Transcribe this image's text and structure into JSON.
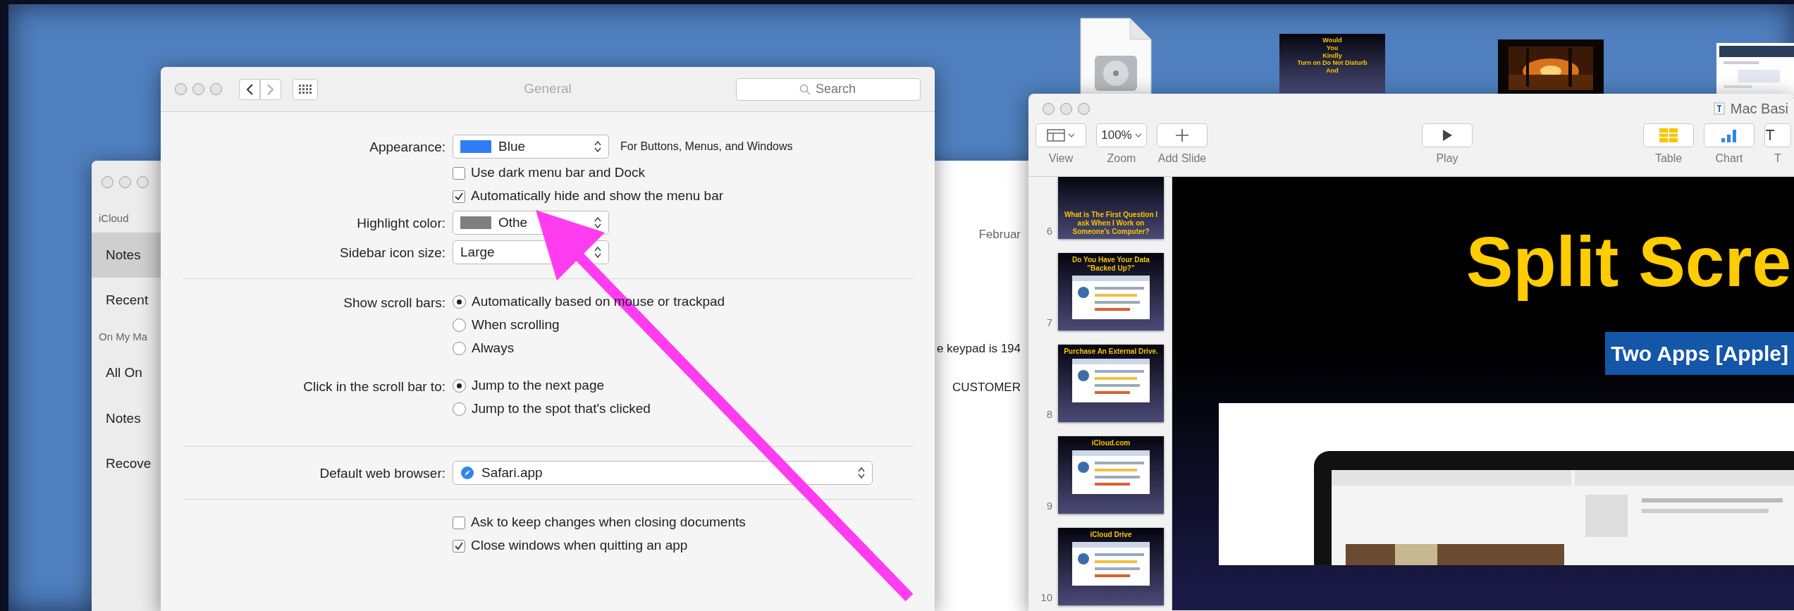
{
  "desktop_icons": [
    {
      "kind": "file"
    },
    {
      "kind": "slide",
      "text": "Would\nYou\nKindly\nTurn on Do Not Disturb\nAnd"
    },
    {
      "kind": "picture"
    },
    {
      "kind": "picture"
    }
  ],
  "notes_window": {
    "sidebar": [
      {
        "kind": "header",
        "label": "iCloud"
      },
      {
        "kind": "item",
        "label": "Notes",
        "selected": true
      },
      {
        "kind": "item",
        "label": "Recent",
        "selected": false
      },
      {
        "kind": "header",
        "label": "On My Ma"
      },
      {
        "kind": "item",
        "label": "All On",
        "selected": false
      },
      {
        "kind": "item",
        "label": "Notes",
        "selected": false
      },
      {
        "kind": "item",
        "label": "Recove",
        "selected": false
      }
    ],
    "date": "Februar",
    "note_lines": [
      "e keypad is 194",
      "CUSTOMER"
    ]
  },
  "preferences": {
    "title": "General",
    "search": {
      "placeholder": "Search"
    },
    "rows": [
      {
        "kind": "popup",
        "label": "Appearance:",
        "value": "Blue",
        "color": "#2f7cf6",
        "note": "For Buttons, Menus, and Windows"
      },
      {
        "kind": "checks",
        "options": [
          {
            "label": "Use dark menu bar and Dock",
            "checked": false
          },
          {
            "label": "Automatically hide and show the menu bar",
            "checked": true
          }
        ]
      },
      {
        "kind": "popup",
        "label": "Highlight color:",
        "value": "Othe",
        "color": "#7f7f7f"
      },
      {
        "kind": "popup",
        "label": "Sidebar icon size:",
        "value": "Large"
      },
      {
        "kind": "divider"
      },
      {
        "kind": "radios",
        "label": "Show scroll bars:",
        "options": [
          {
            "label": "Automatically based on mouse or trackpad",
            "selected": true
          },
          {
            "label": "When scrolling",
            "selected": false
          },
          {
            "label": "Always",
            "selected": false
          }
        ]
      },
      {
        "kind": "radios",
        "label": "Click in the scroll bar to:",
        "options": [
          {
            "label": "Jump to the next page",
            "selected": true
          },
          {
            "label": "Jump to the spot that's clicked",
            "selected": false
          }
        ]
      },
      {
        "kind": "divider"
      },
      {
        "kind": "browser",
        "label": "Default web browser:",
        "value": "Safari.app"
      },
      {
        "kind": "divider"
      },
      {
        "kind": "checks",
        "options": [
          {
            "label": "Ask to keep changes when closing documents",
            "checked": false
          },
          {
            "label": "Close windows when quitting an app",
            "checked": true
          }
        ]
      }
    ]
  },
  "keynote": {
    "title": "Mac Basi",
    "toolbar": [
      {
        "kind": "view",
        "label": "View"
      },
      {
        "kind": "zoom",
        "value": "100%",
        "label": "Zoom"
      },
      {
        "kind": "add",
        "label": "Add Slide"
      },
      {
        "kind": "play",
        "label": "Play"
      },
      {
        "kind": "table",
        "label": "Table"
      },
      {
        "kind": "chart",
        "label": "Chart"
      },
      {
        "kind": "text",
        "label": "T"
      }
    ],
    "slides": [
      {
        "number": "6",
        "kind": "text",
        "title": "What is The First Question I ask When I Work on Someone's Computer?"
      },
      {
        "number": "7",
        "kind": "screenshot",
        "title": "Do You Have Your Data \"Backed Up?\""
      },
      {
        "number": "8",
        "kind": "screenshot",
        "title": "Purchase An External Drive."
      },
      {
        "number": "9",
        "kind": "screenshot",
        "title": "iCloud.com"
      },
      {
        "number": "10",
        "kind": "screenshot",
        "title": "iCloud Drive"
      }
    ],
    "canvas": {
      "title": "Split Scre",
      "subtitle": "Two Apps [Apple]"
    }
  }
}
